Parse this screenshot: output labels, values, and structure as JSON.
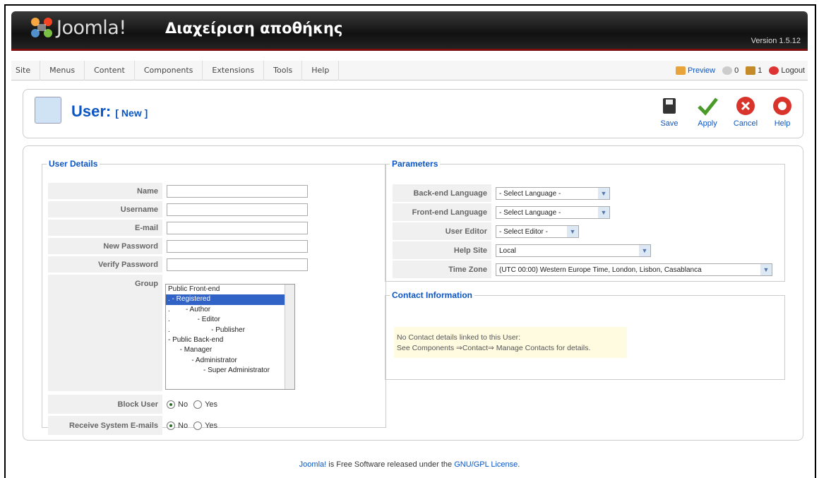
{
  "header": {
    "brand": "Joomla!",
    "title": "Διαχείριση αποθήκης",
    "version": "Version 1.5.12"
  },
  "menu": [
    "Site",
    "Menus",
    "Content",
    "Components",
    "Extensions",
    "Tools",
    "Help"
  ],
  "status": {
    "preview": "Preview",
    "messages": "0",
    "users": "1",
    "logout": "Logout"
  },
  "page": {
    "title": "User:",
    "subtitle": "[ New ]"
  },
  "toolbar": {
    "save": "Save",
    "apply": "Apply",
    "cancel": "Cancel",
    "help": "Help"
  },
  "user_details": {
    "legend": "User Details",
    "name": "Name",
    "username": "Username",
    "email": "E-mail",
    "new_password": "New Password",
    "verify_password": "Verify Password",
    "group": "Group",
    "groups": [
      "Public Front-end",
      ". - Registered",
      ".        - Author",
      ".              - Editor",
      ".                     - Publisher",
      "- Public Back-end",
      "      - Manager",
      "            - Administrator",
      "                  - Super Administrator"
    ],
    "block_user": "Block User",
    "receive_emails": "Receive System E-mails",
    "no": "No",
    "yes": "Yes"
  },
  "parameters": {
    "legend": "Parameters",
    "backend_language": "Back-end Language",
    "frontend_language": "Front-end Language",
    "user_editor": "User Editor",
    "help_site": "Help Site",
    "time_zone": "Time Zone",
    "backend_language_value": "- Select Language -",
    "frontend_language_value": "- Select Language -",
    "user_editor_value": "- Select Editor -",
    "help_site_value": "Local",
    "time_zone_value": "(UTC 00:00) Western Europe Time, London, Lisbon, Casablanca"
  },
  "contact": {
    "legend": "Contact Information",
    "line1": "No Contact details linked to this User:",
    "line2": "See Components ⇒Contact⇒ Manage Contacts for details."
  },
  "footer": {
    "joomla": "Joomla!",
    "text": " is Free Software released under the ",
    "license": "GNU/GPL License",
    "end": "."
  }
}
